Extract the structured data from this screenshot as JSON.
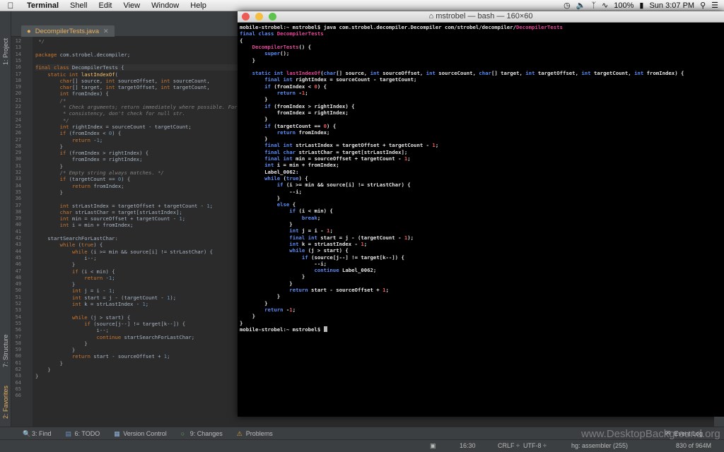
{
  "menubar": {
    "apple_icon": "apple-logo-icon",
    "app_name": "Terminal",
    "items": [
      "Shell",
      "Edit",
      "View",
      "Window",
      "Help"
    ],
    "battery": "100%",
    "clock": "Sun 3:07 PM"
  },
  "ide": {
    "left_tabs": [
      "1: Project",
      "7: Structure",
      "2: Favorites"
    ],
    "file_tab": "DecompilerTests.java",
    "line_numbers": [
      "12",
      "13",
      "14",
      "15",
      "16",
      "17",
      "18",
      "19",
      "20",
      "21",
      "22",
      "23",
      "24",
      "25",
      "26",
      "27",
      "28",
      "29",
      "30",
      "31",
      "32",
      "33",
      "34",
      "35",
      "36",
      "37",
      "38",
      "39",
      "40",
      "41",
      "42",
      "43",
      "44",
      "45",
      "46",
      "47",
      "48",
      "49",
      "50",
      "51",
      "52",
      "53",
      "54",
      "55",
      "56",
      "57",
      "58",
      "59",
      "60",
      "61",
      "62",
      "63",
      "64",
      "65",
      "66"
    ],
    "code_lines": [
      " */",
      "",
      "package com.strobel.decompiler;",
      "",
      "final class DecompilerTests {",
      "    static int lastIndexOf(",
      "        char[] source, int sourceOffset, int sourceCount,",
      "        char[] target, int targetOffset, int targetCount,",
      "        int fromIndex) {",
      "        /*",
      "         * Check arguments; return immediately where possible. For",
      "         * consistency, don't check for null str.",
      "         */",
      "        int rightIndex = sourceCount - targetCount;",
      "        if (fromIndex < 0) {",
      "            return -1;",
      "        }",
      "        if (fromIndex > rightIndex) {",
      "            fromIndex = rightIndex;",
      "        }",
      "        /* Empty string always matches. */",
      "        if (targetCount == 0) {",
      "            return fromIndex;",
      "        }",
      "",
      "        int strLastIndex = targetOffset + targetCount - 1;",
      "        char strLastChar = target[strLastIndex];",
      "        int min = sourceOffset + targetCount - 1;",
      "        int i = min + fromIndex;",
      "",
      "    startSearchForLastChar:",
      "        while (true) {",
      "            while (i >= min && source[i] != strLastChar) {",
      "                i--;",
      "            }",
      "            if (i < min) {",
      "                return -1;",
      "            }",
      "            int j = i - 1;",
      "            int start = j - (targetCount - 1);",
      "            int k = strLastIndex - 1;",
      "",
      "            while (j > start) {",
      "                if (source[j--] != target[k--]) {",
      "                    i--;",
      "                    continue startSearchForLastChar;",
      "                }",
      "            }",
      "            return start - sourceOffset + 1;",
      "        }",
      "    }",
      "}",
      "",
      "",
      ""
    ]
  },
  "terminal": {
    "title": "mstrobel — bash — 160×60",
    "lines": [
      "mobile-strobel:~ mstrobel$ java com.strobel.decompiler.Decompiler com/strobel/decompiler/DecompilerTests",
      "final class DecompilerTests",
      "{",
      "    DecompilerTests() {",
      "        super();",
      "    }",
      "",
      "    static int lastIndexOf(char[] source, int sourceOffset, int sourceCount, char[] target, int targetOffset, int targetCount, int fromIndex) {",
      "        final int rightIndex = sourceCount - targetCount;",
      "        if (fromIndex < 0) {",
      "            return -1;",
      "        }",
      "        if (fromIndex > rightIndex) {",
      "            fromIndex = rightIndex;",
      "        }",
      "        if (targetCount == 0) {",
      "            return fromIndex;",
      "        }",
      "        final int strLastIndex = targetOffset + targetCount - 1;",
      "        final char strLastChar = target[strLastIndex];",
      "        final int min = sourceOffset + targetCount - 1;",
      "        int i = min + fromIndex;",
      "        Label_0062:",
      "        while (true) {",
      "            if (i >= min && source[i] != strLastChar) {",
      "                --i;",
      "            }",
      "            else {",
      "                if (i < min) {",
      "                    break;",
      "                }",
      "                int j = i - 1;",
      "                final int start = j - (targetCount - 1);",
      "                int k = strLastIndex - 1;",
      "                while (j > start) {",
      "                    if (source[j--] != target[k--]) {",
      "                        --i;",
      "                        continue Label_0062;",
      "                    }",
      "                }",
      "                return start - sourceOffset + 1;",
      "            }",
      "        }",
      "        return -1;",
      "    }",
      "}",
      "mobile-strobel:~ mstrobel$ "
    ]
  },
  "bottom_tools": [
    {
      "label": "3: Find",
      "icon": "search-icon"
    },
    {
      "label": "6: TODO",
      "icon": "todo-icon"
    },
    {
      "label": "Version Control",
      "icon": "version-control-icon"
    },
    {
      "label": "9: Changes",
      "icon": "changes-icon"
    },
    {
      "label": "Problems",
      "icon": "warning-icon"
    }
  ],
  "event_log": "Event Log",
  "status": {
    "position": "16:30",
    "line_sep": "CRLF ÷",
    "encoding": "UTF-8 ÷",
    "vcs": "hg: assembler (255)",
    "memory": "830 of 964M"
  },
  "watermark": "www.DesktopBackground.org",
  "colors": {
    "keyword": "#cc7832",
    "type_name": "#ffc66d",
    "comment": "#808080",
    "number": "#6897bb",
    "term_keyword": "#5b8cf5",
    "term_number": "#ef5a5a",
    "term_class": "#e8479b"
  }
}
